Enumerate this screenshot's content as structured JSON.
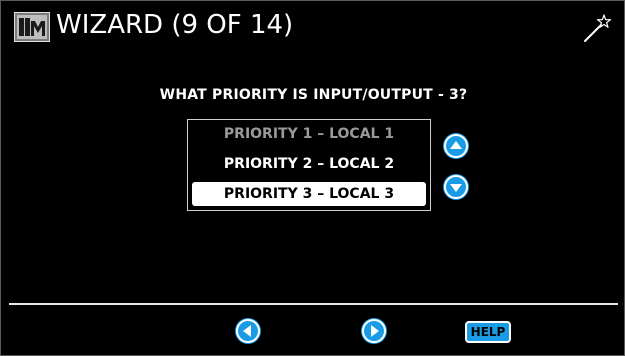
{
  "header": {
    "title": "WIZARD (9 OF 14)",
    "logo_icon": "module-logo-icon",
    "wand_icon": "magic-wand-icon"
  },
  "wizard": {
    "question": "WHAT PRIORITY IS INPUT/OUTPUT - 3?",
    "options": [
      {
        "label": "PRIORITY 1 – LOCAL 1",
        "state": "disabled"
      },
      {
        "label": "PRIORITY 2 – LOCAL 2",
        "state": "normal"
      },
      {
        "label": "PRIORITY 3 – LOCAL 3",
        "state": "selected"
      }
    ],
    "selected_index": 2
  },
  "controls": {
    "scroll_up_icon": "chevron-up-icon",
    "scroll_down_icon": "chevron-down-icon",
    "previous_icon": "chevron-left-icon",
    "next_icon": "chevron-right-icon",
    "help_label": "HELP"
  },
  "colors": {
    "background": "#000000",
    "accent_blue": "#1a9be6",
    "text": "#ffffff",
    "disabled_text": "#9a9a9a",
    "selected_bg": "#ffffff"
  }
}
